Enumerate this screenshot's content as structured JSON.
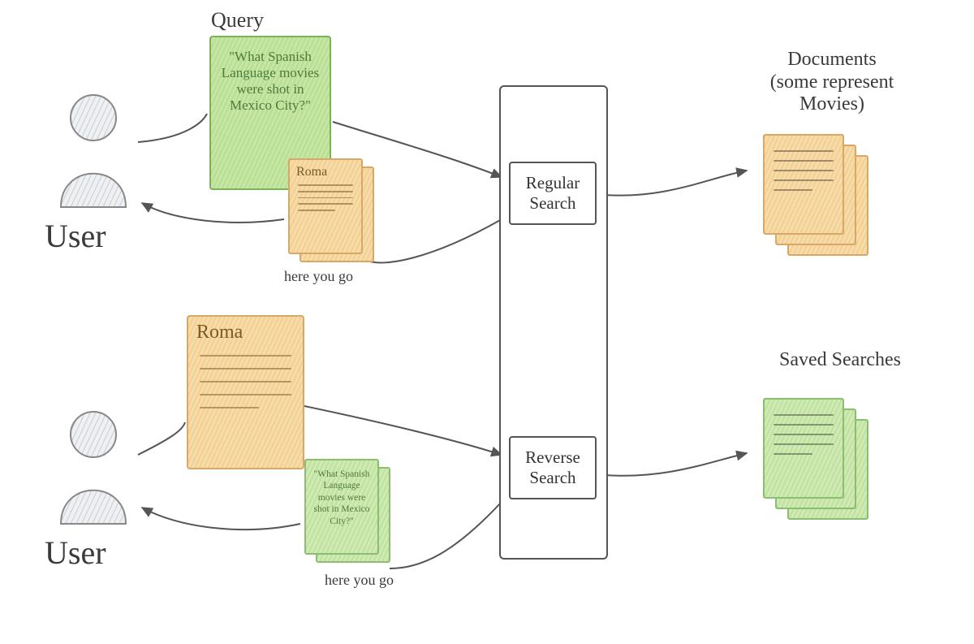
{
  "labels": {
    "user_top": "User",
    "user_bottom": "User",
    "query_header": "Query",
    "roma_small_title": "Roma",
    "roma_big_title": "Roma",
    "here_you_go_top": "here you go",
    "here_you_go_bottom": "here you go",
    "regular_search": "Regular\nSearch",
    "reverse_search": "Reverse\nSearch",
    "documents_header": "Documents\n(some represent\nMovies)",
    "saved_searches_header": "Saved Searches"
  },
  "query_text": "\"What Spanish Language movies were shot in Mexico City?\"",
  "reverse_result_text": "\"What Spanish Language movies were shot in Mexico City?\"",
  "diagram": {
    "description": "Concept sketch comparing Regular Search vs Reverse Search. Top flow: User submits a text Query to Regular Search, which looks through Documents (some representing Movies) and returns a movie document 'Roma'. Bottom flow: User submits a document 'Roma' to Reverse Search, which looks through Saved Searches and returns the matching saved query.",
    "nodes": [
      {
        "id": "user_top",
        "type": "actor",
        "label": "User"
      },
      {
        "id": "user_bottom",
        "type": "actor",
        "label": "User"
      },
      {
        "id": "query",
        "type": "input-green",
        "label": "\"What Spanish Language movies were shot in Mexico City?\""
      },
      {
        "id": "roma_doc",
        "type": "input-orange",
        "label": "Roma"
      },
      {
        "id": "regular_search",
        "type": "process",
        "label": "Regular Search"
      },
      {
        "id": "reverse_search",
        "type": "process",
        "label": "Reverse Search"
      },
      {
        "id": "documents_store",
        "type": "store-orange",
        "label": "Documents (some represent Movies)"
      },
      {
        "id": "saved_searches_store",
        "type": "store-green",
        "label": "Saved Searches"
      },
      {
        "id": "result_roma",
        "type": "output-orange",
        "label": "Roma"
      },
      {
        "id": "result_query",
        "type": "output-green",
        "label": "\"What Spanish Language movies were shot in Mexico City?\""
      }
    ],
    "edges": [
      {
        "from": "user_top",
        "to": "query"
      },
      {
        "from": "query",
        "to": "regular_search"
      },
      {
        "from": "regular_search",
        "to": "documents_store"
      },
      {
        "from": "regular_search",
        "to": "result_roma",
        "label": "here you go"
      },
      {
        "from": "result_roma",
        "to": "user_top"
      },
      {
        "from": "user_bottom",
        "to": "roma_doc"
      },
      {
        "from": "roma_doc",
        "to": "reverse_search"
      },
      {
        "from": "reverse_search",
        "to": "saved_searches_store"
      },
      {
        "from": "reverse_search",
        "to": "result_query",
        "label": "here you go"
      },
      {
        "from": "result_query",
        "to": "user_bottom"
      }
    ]
  }
}
